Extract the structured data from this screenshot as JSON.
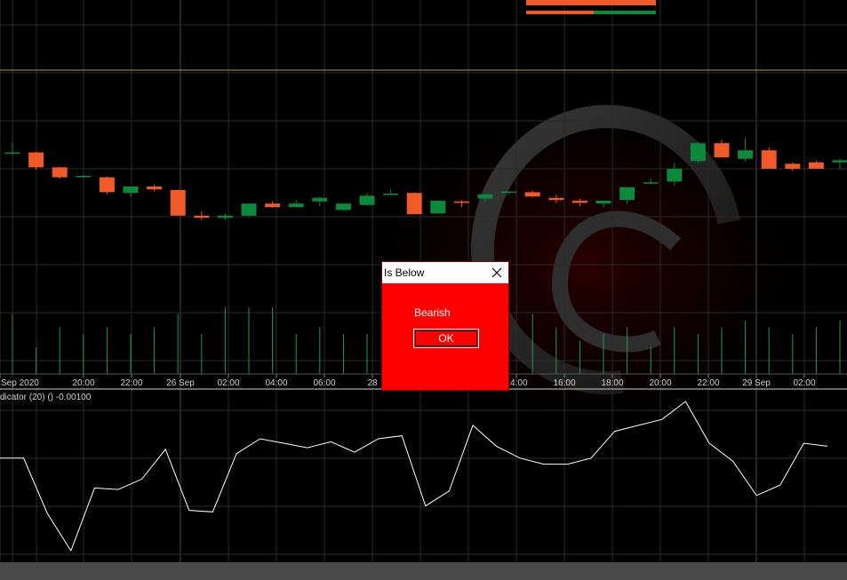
{
  "colors": {
    "background": "#000000",
    "grid": "#2a2a2a",
    "bull": "#0b8a3b",
    "bear": "#f05a28",
    "price_line": "#b59a4a",
    "indicator_line": "#ffffff",
    "volume": "#1f9a4a",
    "dialog_bg": "#ff0000"
  },
  "chart_data": {
    "type": "candlestick",
    "y_range": [
      0,
      100
    ],
    "horizontal_level": 76,
    "x_tick_labels": [
      "Sep 2020",
      "20:00",
      "22:00",
      "26 Sep",
      "02:00",
      "04:00",
      "06:00",
      "28",
      "14:00",
      "16:00",
      "18:00",
      "20:00",
      "22:00",
      "29 Sep",
      "02:00"
    ],
    "candles": [
      {
        "o": 73,
        "h": 88,
        "l": 70,
        "c": 73
      },
      {
        "o": 73,
        "h": 74,
        "l": 49,
        "c": 52
      },
      {
        "o": 52,
        "h": 53,
        "l": 36,
        "c": 38
      },
      {
        "o": 40,
        "h": 42,
        "l": 40,
        "c": 40
      },
      {
        "o": 38,
        "h": 39,
        "l": 14,
        "c": 17
      },
      {
        "o": 16,
        "h": 17,
        "l": 11,
        "c": 25
      },
      {
        "o": 25,
        "h": 28,
        "l": 18,
        "c": 21
      },
      {
        "o": 20,
        "h": 21,
        "l": -5,
        "c": -16
      },
      {
        "o": -16,
        "h": -10,
        "l": -22,
        "c": -19
      },
      {
        "o": -19,
        "h": -13,
        "l": -22,
        "c": -16
      },
      {
        "o": -16,
        "h": 2,
        "l": -18,
        "c": 1
      },
      {
        "o": 1,
        "h": 4,
        "l": -5,
        "c": -4
      },
      {
        "o": -4,
        "h": 6,
        "l": -4,
        "c": 1
      },
      {
        "o": 4,
        "h": 11,
        "l": -3,
        "c": 9
      },
      {
        "o": -8,
        "h": -4,
        "l": -9,
        "c": 1
      },
      {
        "o": -1,
        "h": 16,
        "l": -2,
        "c": 12
      },
      {
        "o": 14,
        "h": 21,
        "l": 14,
        "c": 15
      },
      {
        "o": 16,
        "h": 17,
        "l": -11,
        "c": -14
      },
      {
        "o": -13,
        "h": 6,
        "l": -13,
        "c": 5
      },
      {
        "o": 4,
        "h": 6,
        "l": -4,
        "c": 2
      },
      {
        "o": 8,
        "h": 14,
        "l": 4,
        "c": 14
      },
      {
        "o": 17,
        "h": 17,
        "l": 14,
        "c": 18
      },
      {
        "o": 17,
        "h": 19,
        "l": 10,
        "c": 11
      },
      {
        "o": 9,
        "h": 13,
        "l": 2,
        "c": 6
      },
      {
        "o": 5,
        "h": 8,
        "l": -3,
        "c": 2
      },
      {
        "o": 1,
        "h": 5,
        "l": -4,
        "c": 5
      },
      {
        "o": 6,
        "h": 14,
        "l": 1,
        "c": 24
      },
      {
        "o": 30,
        "h": 36,
        "l": 28,
        "c": 31
      },
      {
        "o": 32,
        "h": 58,
        "l": 26,
        "c": 50
      },
      {
        "o": 61,
        "h": 88,
        "l": 58,
        "c": 86
      },
      {
        "o": 86,
        "h": 91,
        "l": 66,
        "c": 66
      },
      {
        "o": 64,
        "h": 94,
        "l": 60,
        "c": 76
      },
      {
        "o": 76,
        "h": 80,
        "l": 50,
        "c": 50
      },
      {
        "o": 57,
        "h": 59,
        "l": 47,
        "c": 50
      },
      {
        "o": 59,
        "h": 61,
        "l": 51,
        "c": 50
      },
      {
        "o": 59,
        "h": 64,
        "l": 50,
        "c": 62
      }
    ],
    "indicator": {
      "label": "dicator (20) () -0.00100",
      "values": [
        62,
        62,
        25,
        0,
        42,
        41,
        48,
        68,
        27,
        26,
        65,
        75,
        72,
        69,
        73,
        66,
        75,
        77,
        30,
        40,
        84,
        70,
        62,
        58,
        58,
        62,
        80,
        84,
        88,
        100,
        72,
        60,
        37,
        44,
        72,
        70
      ]
    },
    "volume": [
      45,
      20,
      35,
      30,
      35,
      30,
      35,
      45,
      30,
      50,
      50,
      50,
      30,
      35,
      30,
      30,
      30,
      35,
      45,
      40,
      20,
      35,
      45,
      35,
      25,
      30,
      35,
      20,
      35,
      30,
      35,
      40,
      35,
      30,
      35,
      40
    ]
  },
  "dialog": {
    "title": "Is Below",
    "message": "Bearish",
    "ok_label": "OK"
  }
}
